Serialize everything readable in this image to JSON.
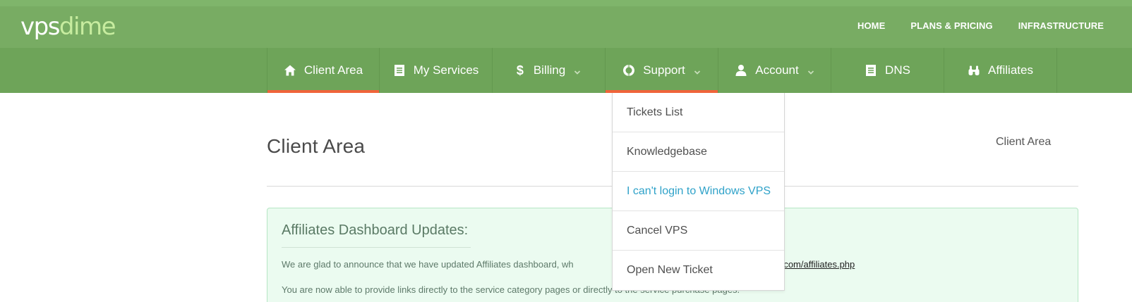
{
  "brand": {
    "part1": "vps",
    "part2": "dime"
  },
  "top_nav": [
    "HOME",
    "PLANS & PRICING",
    "INFRASTRUCTURE"
  ],
  "main_nav": [
    {
      "label": "Client Area",
      "icon": "home-icon",
      "active": true,
      "has_dropdown": false
    },
    {
      "label": "My Services",
      "icon": "document-icon",
      "active": false,
      "has_dropdown": false
    },
    {
      "label": "Billing",
      "icon": "dollar-icon",
      "active": false,
      "has_dropdown": true
    },
    {
      "label": "Support",
      "icon": "lifebuoy-icon",
      "active": true,
      "has_dropdown": true
    },
    {
      "label": "Account",
      "icon": "user-icon",
      "active": false,
      "has_dropdown": true
    },
    {
      "label": "DNS",
      "icon": "document-icon",
      "active": false,
      "has_dropdown": false
    },
    {
      "label": "Affiliates",
      "icon": "binoculars-icon",
      "active": false,
      "has_dropdown": false
    }
  ],
  "support_menu": [
    "Tickets List",
    "Knowledgebase",
    "I can't login to Windows VPS",
    "Cancel VPS",
    "Open New Ticket"
  ],
  "page": {
    "title": "Client Area",
    "breadcrumb": "Client Area"
  },
  "notice": {
    "title": "Affiliates Dashboard Updates:",
    "line1_text": "We are glad to announce that we have updated Affiliates dashboard, wh",
    "line1_link": "me.com/affiliates.php",
    "line2": "You are now able to provide links directly to the service category pages or directly to the service purchase pages."
  },
  "colors": {
    "topbar": "#78ac63",
    "mainnav": "#6ea459",
    "active_underline": "#f0643a",
    "highlight_link": "#2fa2c9",
    "notice_bg": "#ebfbf0"
  }
}
